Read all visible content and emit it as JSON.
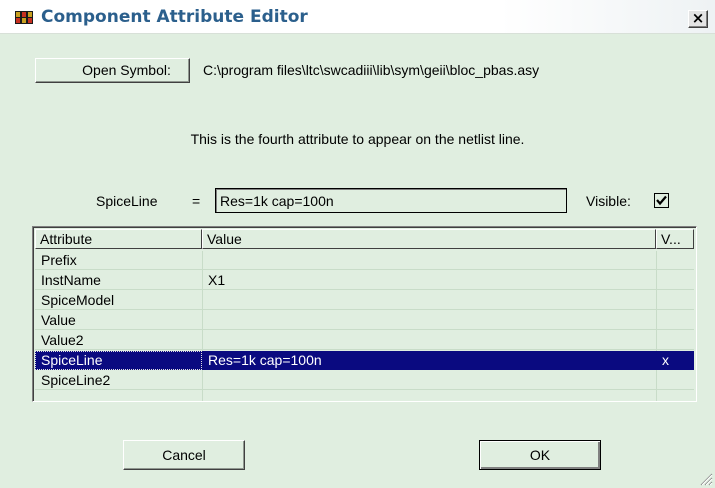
{
  "window": {
    "title": "Component Attribute Editor",
    "close_label": "×"
  },
  "open_symbol": {
    "button_label": "Open Symbol:",
    "path": "C:\\program files\\ltc\\swcadiii\\lib\\sym\\geii\\bloc_pbas.asy"
  },
  "info": "This is the fourth attribute to appear on the netlist line.",
  "field": {
    "label": "SpiceLine",
    "equals": "=",
    "value": "Res=1k cap=100n",
    "visible_label": "Visible:",
    "visible_checked": true
  },
  "table": {
    "headers": [
      "Attribute",
      "Value",
      "V..."
    ],
    "rows": [
      {
        "attribute": "Prefix",
        "value": "",
        "visible": ""
      },
      {
        "attribute": "InstName",
        "value": "X1",
        "visible": ""
      },
      {
        "attribute": "SpiceModel",
        "value": "",
        "visible": ""
      },
      {
        "attribute": "Value",
        "value": "",
        "visible": ""
      },
      {
        "attribute": "Value2",
        "value": "",
        "visible": ""
      },
      {
        "attribute": "SpiceLine",
        "value": "Res=1k cap=100n",
        "visible": "x"
      },
      {
        "attribute": "SpiceLine2",
        "value": "",
        "visible": ""
      }
    ],
    "selected_index": 5
  },
  "buttons": {
    "cancel": "Cancel",
    "ok": "OK"
  },
  "colors": {
    "dialog_bg": "#e0eee0",
    "title_text": "#2b5f8c",
    "selection_bg": "#0a0a80"
  }
}
